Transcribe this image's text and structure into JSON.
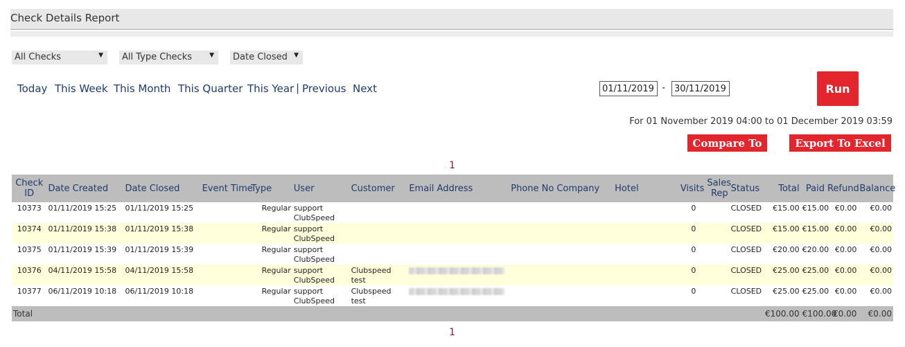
{
  "title": "Check Details Report",
  "filters": {
    "checks": "All Checks",
    "types": "All Type Checks",
    "date_mode": "Date Closed"
  },
  "quick_ranges": [
    "Today",
    "This Week",
    "This Month",
    "This Quarter",
    "This Year"
  ],
  "nav": {
    "separator": "|",
    "previous": "Previous",
    "next": "Next"
  },
  "date_from": "01/11/2019",
  "date_sep": "-",
  "date_to": "30/11/2019",
  "run_label": "Run",
  "range_text": "For 01 November 2019 04:00 to 01 December 2019 03:59",
  "compare_label": "Compare To",
  "export_label": "Export To Excel",
  "page_number": "1",
  "columns": {
    "check_id": "Check ID",
    "date_created": "Date Created",
    "date_closed": "Date Closed",
    "event_time": "Event Time",
    "type": "Type",
    "user": "User",
    "customer": "Customer",
    "email": "Email Address",
    "phone": "Phone No",
    "company": "Company",
    "hotel": "Hotel",
    "visits": "Visits",
    "sales_rep": "Sales Rep",
    "status": "Status",
    "total": "Total",
    "paid": "Paid",
    "refund": "Refund",
    "balance": "Balance"
  },
  "rows": [
    {
      "id": "10373",
      "created": "01/11/2019 15:25",
      "closed": "01/11/2019 15:25",
      "event_time": "",
      "type": "Regular",
      "user": "support ClubSpeed",
      "customer": "",
      "email_redacted": false,
      "phone": "",
      "company": "",
      "hotel": "",
      "visits": "0",
      "sales_rep": "",
      "status": "CLOSED",
      "total": "€15.00",
      "paid": "€15.00",
      "refund": "€0.00",
      "balance": "€0.00"
    },
    {
      "id": "10374",
      "created": "01/11/2019 15:38",
      "closed": "01/11/2019 15:38",
      "event_time": "",
      "type": "Regular",
      "user": "support ClubSpeed",
      "customer": "",
      "email_redacted": false,
      "phone": "",
      "company": "",
      "hotel": "",
      "visits": "0",
      "sales_rep": "",
      "status": "CLOSED",
      "total": "€15.00",
      "paid": "€15.00",
      "refund": "€0.00",
      "balance": "€0.00"
    },
    {
      "id": "10375",
      "created": "01/11/2019 15:39",
      "closed": "01/11/2019 15:39",
      "event_time": "",
      "type": "Regular",
      "user": "support ClubSpeed",
      "customer": "",
      "email_redacted": false,
      "phone": "",
      "company": "",
      "hotel": "",
      "visits": "0",
      "sales_rep": "",
      "status": "CLOSED",
      "total": "€20.00",
      "paid": "€20.00",
      "refund": "€0.00",
      "balance": "€0.00"
    },
    {
      "id": "10376",
      "created": "04/11/2019 15:58",
      "closed": "04/11/2019 15:58",
      "event_time": "",
      "type": "Regular",
      "user": "support ClubSpeed",
      "customer": "Clubspeed test",
      "email_redacted": true,
      "phone": "",
      "company": "",
      "hotel": "",
      "visits": "0",
      "sales_rep": "",
      "status": "CLOSED",
      "total": "€25.00",
      "paid": "€25.00",
      "refund": "€0.00",
      "balance": "€0.00"
    },
    {
      "id": "10377",
      "created": "06/11/2019 10:18",
      "closed": "06/11/2019 10:18",
      "event_time": "",
      "type": "Regular",
      "user": "support ClubSpeed",
      "customer": "Clubspeed test",
      "email_redacted": true,
      "phone": "",
      "company": "",
      "hotel": "",
      "visits": "0",
      "sales_rep": "",
      "status": "CLOSED",
      "total": "€25.00",
      "paid": "€25.00",
      "refund": "€0.00",
      "balance": "€0.00"
    }
  ],
  "totals": {
    "label": "Total",
    "total": "€100.00",
    "paid": "€100.00",
    "refund": "€0.00",
    "balance": "€0.00"
  },
  "colors": {
    "accent": "#e3262e",
    "link": "#1f3a6b",
    "header_bg": "#bdbdbd",
    "alt_row": "#ffffdb",
    "pager": "#8b1a3a"
  }
}
